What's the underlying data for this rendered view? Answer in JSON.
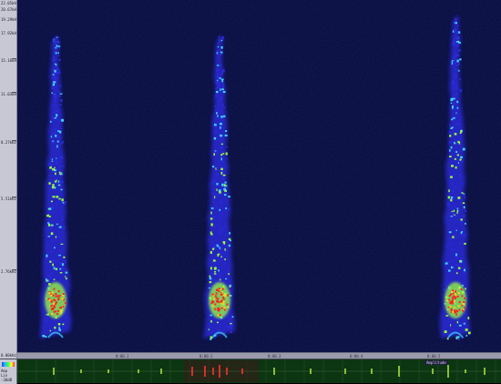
{
  "ruler": {
    "labels": [
      "22.05kHz",
      "20.67kHz",
      "19.29kHz",
      "17.92kHz",
      "15.16kHz",
      "11.03kHz",
      "8.27kHz",
      "5.51kHz",
      "2.76kHz",
      "0.00kHz"
    ]
  },
  "time_ruler": {
    "labels": [
      "0:00.1",
      "0:00.2",
      "0:00.3",
      "0:00.4",
      "0:00.5"
    ]
  },
  "wave": {
    "title": "Amplitude",
    "side_labels": [
      "Amp",
      "Lin",
      "-30dB"
    ]
  },
  "colors": {
    "spectrogram_bg": "#050a3a",
    "low": "#2a2ad8",
    "mid": "#3fd0ff",
    "high": "#9bff3a",
    "peak": "#ff2020",
    "waveform": "#a8e040",
    "selection": "#ff3030"
  }
}
